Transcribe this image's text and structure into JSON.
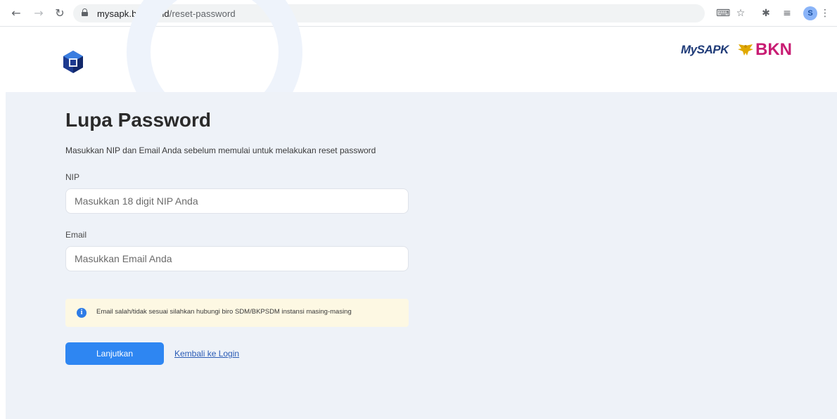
{
  "browser": {
    "url_domain": "mysapk.bkn.go.id",
    "url_path": "/reset-password",
    "profile_initial": "S"
  },
  "brand": {
    "mysapk": "MySAPK",
    "bkn": "BKN"
  },
  "form": {
    "title": "Lupa Password",
    "subtitle": "Masukkan NIP dan Email Anda sebelum memulai untuk melakukan reset password",
    "nip_label": "NIP",
    "nip_placeholder": "Masukkan 18 digit NIP Anda",
    "email_label": "Email",
    "email_placeholder": "Masukkan Email Anda",
    "alert_text": "Email salah/tidak sesuai silahkan hubungi biro SDM/BKPSDM instansi masing-masing",
    "submit_label": "Lanjutkan",
    "back_link": "Kembali ke Login"
  },
  "colors": {
    "primary": "#2e86f2",
    "panel_bg": "#eef2f8",
    "alert_bg": "#fdf8e3",
    "bkn_brand": "#c81c73"
  }
}
